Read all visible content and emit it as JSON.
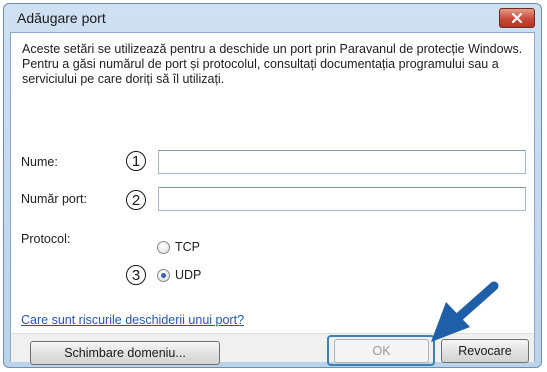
{
  "window": {
    "title": "Adăugare port",
    "close_icon": "close-icon"
  },
  "description": "Aceste setări se utilizează pentru a deschide un port prin Paravanul de protecție Windows. Pentru a găsi numărul de port și protocolul, consultați documentația programului sau a serviciului pe care doriți să îl utilizați.",
  "form": {
    "name_label": "Nume:",
    "name_value": "",
    "port_label": "Număr port:",
    "port_value": "",
    "protocol_label": "Protocol:",
    "protocol_options": [
      "TCP",
      "UDP"
    ],
    "protocol_selected": "UDP"
  },
  "callouts": [
    "1",
    "2",
    "3"
  ],
  "link": "Care sunt riscurile deschiderii unui port?",
  "buttons": {
    "change_scope": "Schimbare domeniu...",
    "ok": "OK",
    "cancel": "Revocare"
  },
  "colors": {
    "accent": "#1f5fa8",
    "link": "#2256b8",
    "close": "#c8493a"
  }
}
